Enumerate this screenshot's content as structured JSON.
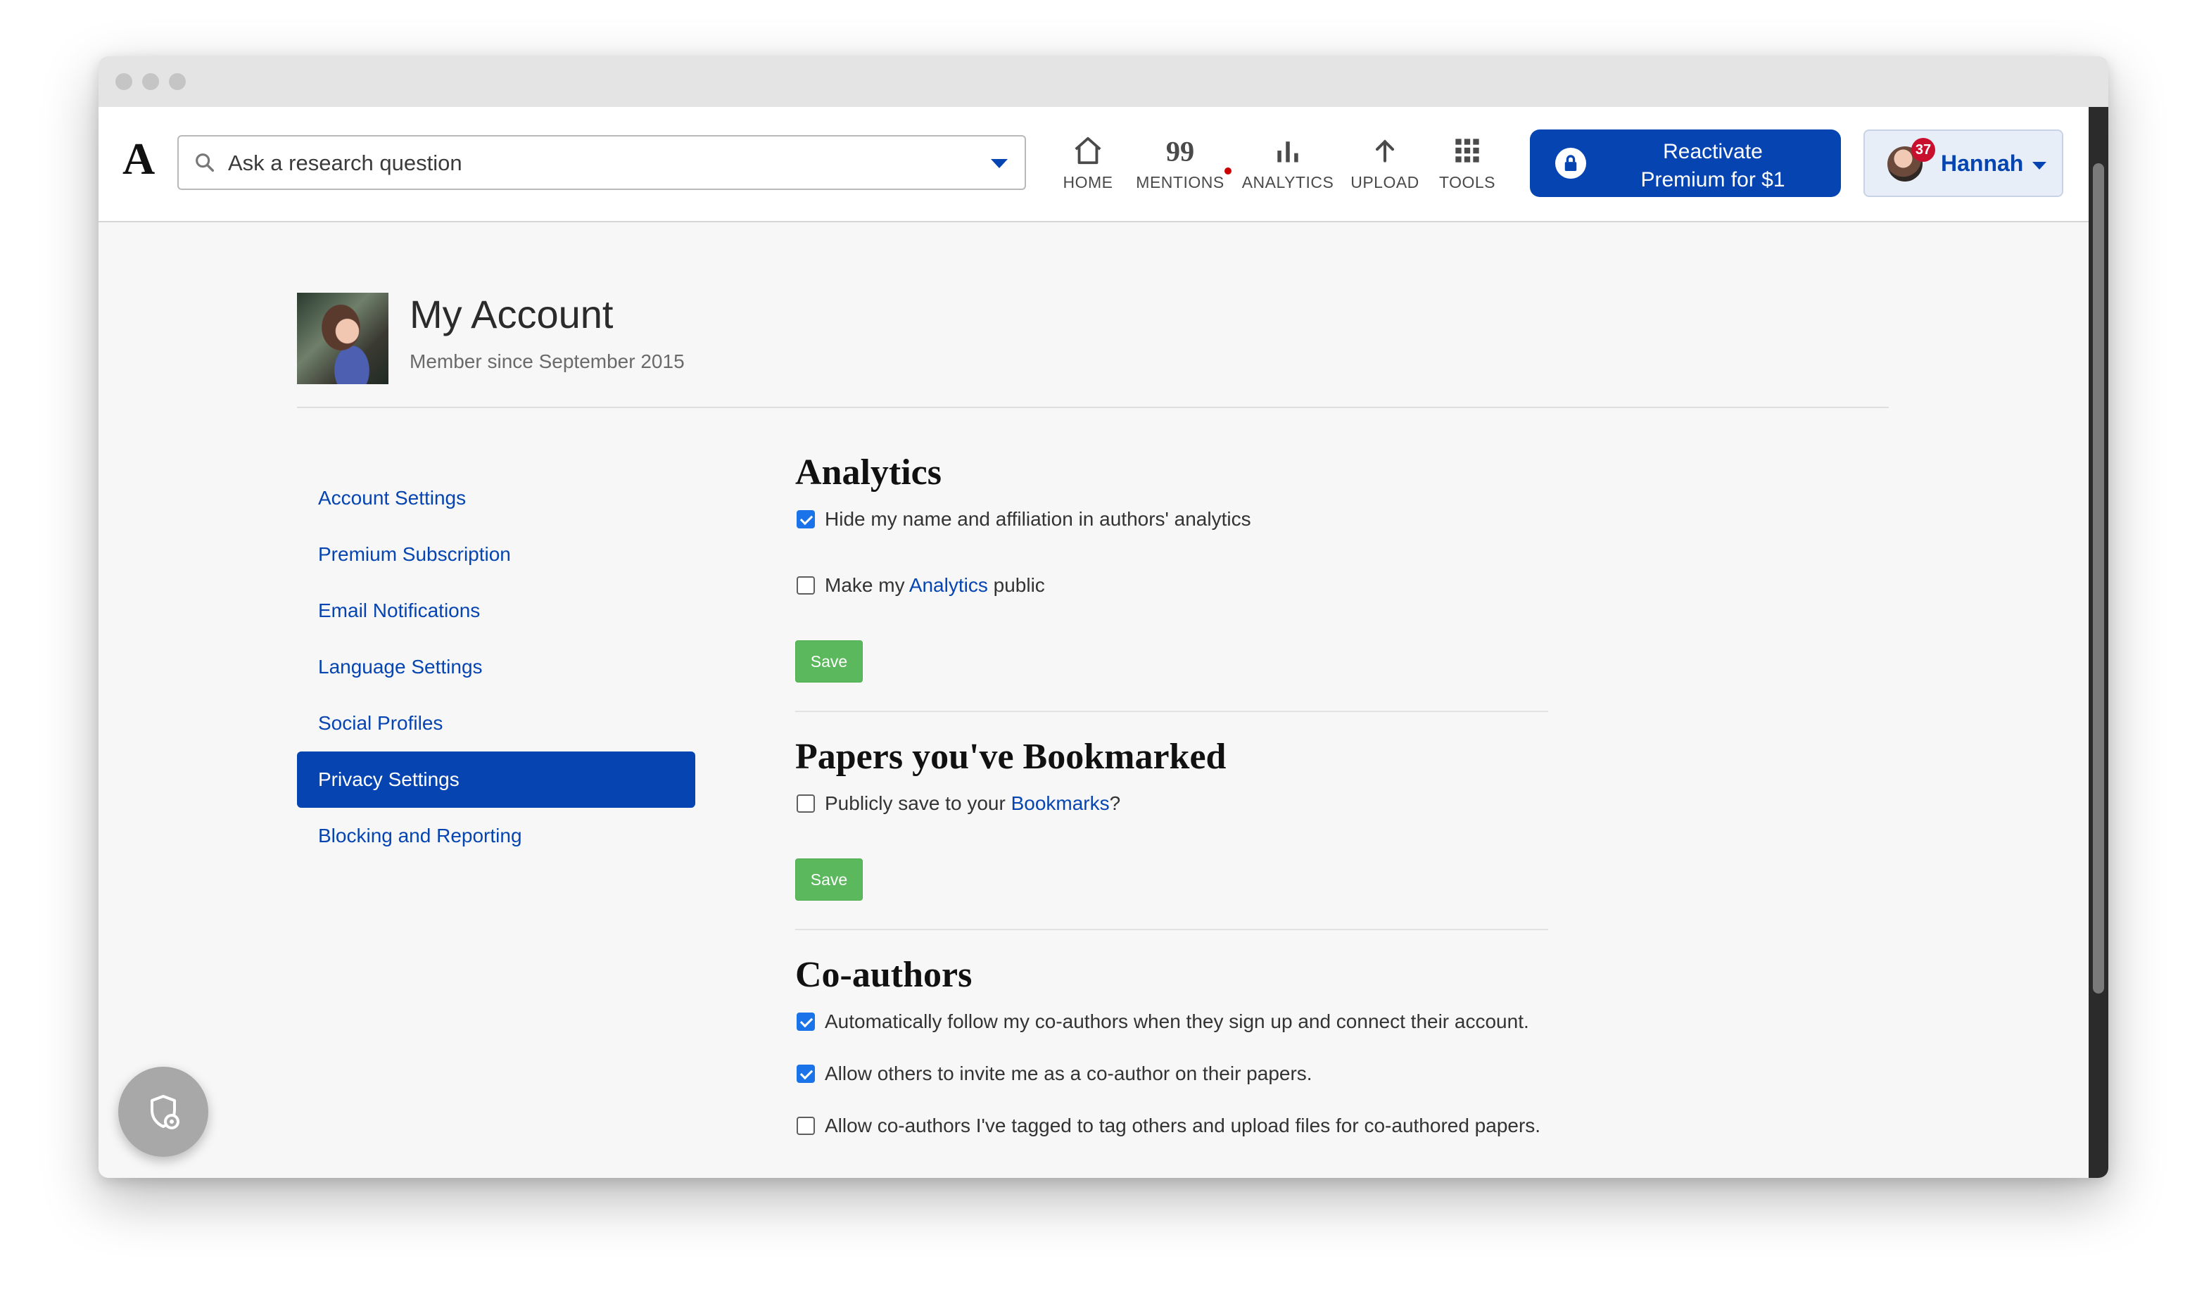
{
  "search": {
    "placeholder": "Ask a research question"
  },
  "nav": {
    "home": "HOME",
    "mentions": "MENTIONS",
    "analytics": "ANALYTICS",
    "upload": "UPLOAD",
    "tools": "TOOLS"
  },
  "premium": {
    "line1": "Reactivate",
    "line2": "Premium for $1"
  },
  "user": {
    "name": "Hannah",
    "notification_count": "37"
  },
  "account": {
    "title": "My Account",
    "member_since": "Member since September 2015"
  },
  "sidebar": {
    "items": [
      {
        "label": "Account Settings",
        "active": false
      },
      {
        "label": "Premium Subscription",
        "active": false
      },
      {
        "label": "Email Notifications",
        "active": false
      },
      {
        "label": "Language Settings",
        "active": false
      },
      {
        "label": "Social Profiles",
        "active": false
      },
      {
        "label": "Privacy Settings",
        "active": true
      },
      {
        "label": "Blocking and Reporting",
        "active": false
      }
    ]
  },
  "analytics": {
    "title": "Analytics",
    "hide_name": {
      "label": "Hide my name and affiliation in authors' analytics",
      "checked": true
    },
    "public": {
      "prefix": "Make my ",
      "link": "Analytics",
      "suffix": " public",
      "checked": false
    },
    "save": "Save"
  },
  "bookmarks": {
    "title": "Papers you've Bookmarked",
    "public": {
      "prefix": "Publicly save to your ",
      "link": "Bookmarks",
      "suffix": "?",
      "checked": false
    },
    "save": "Save"
  },
  "coauthors": {
    "title": "Co-authors",
    "follow": {
      "label": "Automatically follow my co-authors when they sign up and connect their account.",
      "checked": true
    },
    "invite": {
      "label": "Allow others to invite me as a co-author on their papers.",
      "checked": true
    },
    "tag": {
      "label": "Allow co-authors I've tagged to tag others and upload files for co-authored papers.",
      "checked": false
    }
  },
  "colors": {
    "brand_blue": "#0645b1",
    "save_green": "#5cb85c",
    "badge_red": "#c8102e"
  }
}
